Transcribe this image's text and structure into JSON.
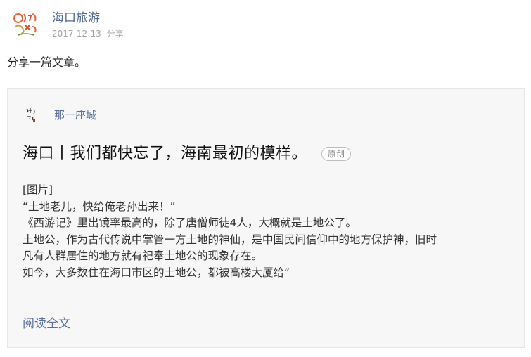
{
  "post": {
    "author": "海口旅游",
    "date": "2017-12-13",
    "action": "分享",
    "text": "分享一篇文章。",
    "avatar_icon": "hainan-travel-logo"
  },
  "article": {
    "source": "那一座城",
    "source_icon": "calligraphy-seal-logo",
    "title": "海口丨我们都快忘了，海南最初的模样。",
    "badge": "原创",
    "body": [
      "[图片]",
      "“土地老儿，快给俺老孙出来！”",
      "《西游记》里出镜率最高的，除了唐僧师徒4人，大概就是土地公了。",
      "土地公，作为古代传说中掌管一方土地的神仙，是中国民间信仰中的地方保护神，旧时",
      "凡有人群居住的地方就有祀奉土地公的现象存在。",
      "如今，大多数住在海口市区的土地公，都被高楼大厦给“"
    ],
    "read_more": "阅读全文"
  },
  "colors": {
    "link": "#5a7099",
    "meta": "#a3a3a3",
    "card_bg": "#f7f7f7",
    "card_border": "#e6e6e6"
  }
}
